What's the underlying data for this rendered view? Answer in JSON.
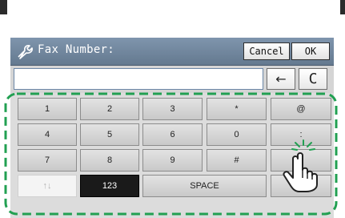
{
  "titlebar": {
    "title": "Fax Number:",
    "cancel_label": "Cancel",
    "ok_label": "OK",
    "icon": "wrench-icon"
  },
  "input": {
    "value": "",
    "back_label": "←",
    "clear_label": "C"
  },
  "keypad": {
    "rows": [
      [
        "1",
        "2",
        "3",
        "*",
        "@"
      ],
      [
        "4",
        "5",
        "6",
        "0",
        ":"
      ],
      [
        "7",
        "8",
        "9",
        "#",
        ""
      ]
    ],
    "bottom": {
      "arrows": "↑↓",
      "mode": "123",
      "space": "SPACE"
    }
  },
  "colors": {
    "highlight_frame": "#22a052",
    "titlebar": "#6e8399",
    "selected_mode": "#1a1a1a"
  }
}
